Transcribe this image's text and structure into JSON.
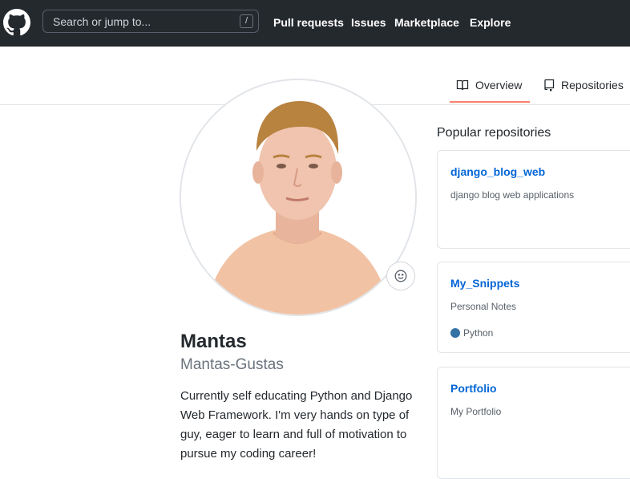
{
  "header": {
    "search_placeholder": "Search or jump to...",
    "search_shortcut": "/",
    "nav": [
      "Pull requests",
      "Issues",
      "Marketplace",
      "Explore"
    ]
  },
  "tabs": [
    {
      "label": "Overview",
      "icon": "book-icon",
      "active": true
    },
    {
      "label": "Repositories",
      "icon": "repo-icon",
      "active": false
    }
  ],
  "profile": {
    "full_name": "Mantas",
    "username": "Mantas-Gustas",
    "bio": "Currently self educating Python and Django Web Framework. I'm very hands on type of guy, eager to learn and full of motivation to pursue my coding career!"
  },
  "popular": {
    "title": "Popular repositories",
    "repos": [
      {
        "name": "django_blog_web",
        "description": "django blog web applications",
        "language": ""
      },
      {
        "name": "My_Snippets",
        "description": "Personal Notes",
        "language": "Python",
        "language_color": "#3572A5"
      },
      {
        "name": "Portfolio",
        "description": "My Portfolio",
        "language": ""
      }
    ]
  }
}
